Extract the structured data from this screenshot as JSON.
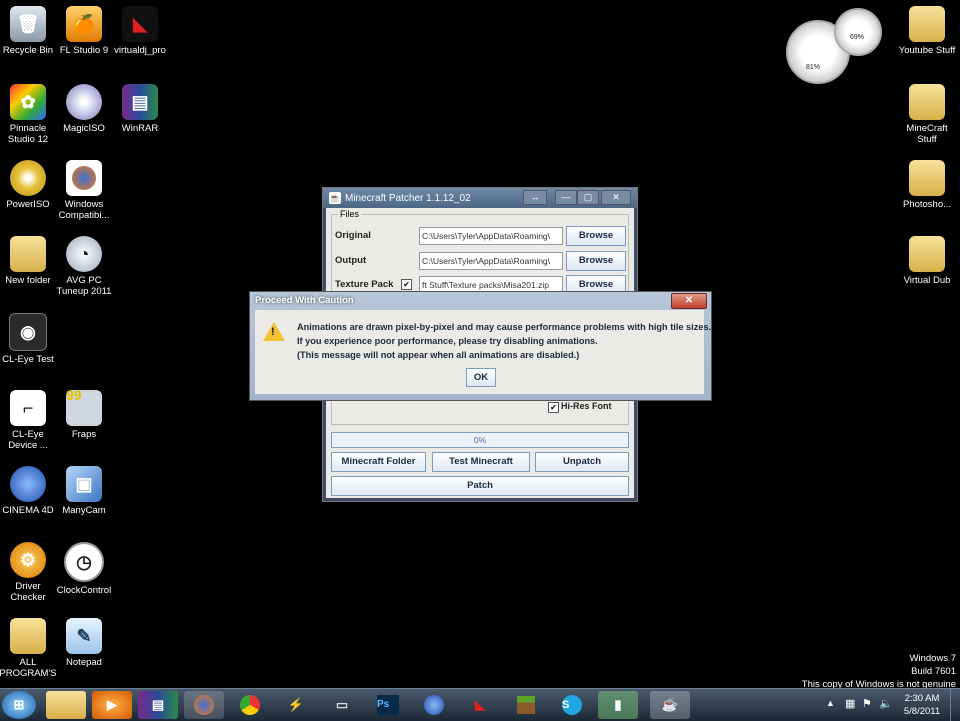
{
  "desktop_icons": {
    "recycle_bin": "Recycle Bin",
    "fl_studio": "FL Studio 9",
    "virtualdj": "virtualdj_pro",
    "pinnacle": "Pinnacle Studio 12",
    "magiciso": "MagicISO",
    "winrar": "WinRAR",
    "poweriso": "PowerISO",
    "windows_compat": "Windows Compatibi...",
    "new_folder": "New folder",
    "avg": "AVG PC Tuneup 2011",
    "cl_eye_test": "CL-Eye Test",
    "cl_eye_device": "CL-Eye Device ...",
    "fraps": "Fraps",
    "cinema4d": "CINEMA 4D",
    "manycam": "ManyCam",
    "driver_checker": "Driver Checker",
    "clockcontrol": "ClockControl",
    "all_programs": "ALL PROGRAM'S",
    "notepad": "Notepad",
    "youtube_stuff": "Youtube Stuff",
    "minecraft_stuff": "MineCraft Stuff",
    "photosho": "Photosho...",
    "virtual_dub": "Virtual Dub"
  },
  "gadget": {
    "cpu": "81%",
    "mem": "69%"
  },
  "patcher": {
    "title": "Minecraft Patcher 1.1.12_02",
    "files_legend": "Files",
    "original_label": "Original",
    "original_path": "C:\\Users\\Tyler\\AppData\\Roaming\\",
    "output_label": "Output",
    "output_path": "C:\\Users\\Tyler\\AppData\\Roaming\\",
    "texture_label": "Texture Pack",
    "texture_checked": "✔",
    "texture_path": "ft Stuff\\Texture packs\\Misa201.zip",
    "browse": "Browse",
    "hires_font": "Hi-Res Font",
    "hires_checked": "✔",
    "progress": "0%",
    "minecraft_folder": "Minecraft Folder",
    "test_minecraft": "Test Minecraft",
    "unpatch": "Unpatch",
    "patch": "Patch",
    "resize_icon": "↔",
    "min_icon": "—",
    "max_icon": "▢",
    "close_icon": "✕"
  },
  "dialog": {
    "title": "Proceed With Caution",
    "line1": "Animations are drawn pixel-by-pixel and may cause performance problems with high tile sizes.",
    "line2": "If you experience poor performance, please try disabling animations.",
    "line3": "(This message will not appear when all animations are disabled.)",
    "ok": "OK",
    "close_icon": "✕",
    "warning_icon": "!"
  },
  "watermark": {
    "line1": "Windows 7",
    "line2": "Build 7601",
    "line3": "This copy of Windows is not genuine"
  },
  "tray": {
    "time": "2:30 AM",
    "date": "5/8/2011"
  },
  "taskbar_items": [
    "start",
    "folder",
    "media",
    "winrar",
    "firefox",
    "chrome",
    "winamp",
    "video",
    "photoshop",
    "cinema4d",
    "virtualdj",
    "minecraft",
    "skype",
    "camera",
    "java"
  ]
}
